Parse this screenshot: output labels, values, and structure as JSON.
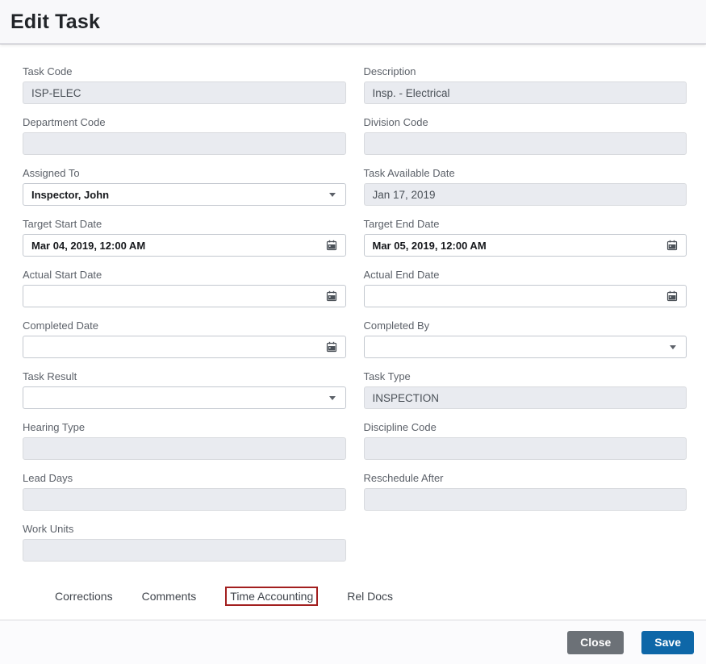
{
  "header": {
    "title": "Edit Task"
  },
  "form": {
    "fields": {
      "task_code": {
        "label": "Task Code",
        "value": "ISP-ELEC"
      },
      "description": {
        "label": "Description",
        "value": "Insp. - Electrical"
      },
      "department_code": {
        "label": "Department Code",
        "value": ""
      },
      "division_code": {
        "label": "Division Code",
        "value": ""
      },
      "assigned_to": {
        "label": "Assigned To",
        "value": "Inspector, John"
      },
      "task_available_date": {
        "label": "Task Available Date",
        "value": "Jan 17, 2019"
      },
      "target_start_date": {
        "label": "Target Start Date",
        "value": "Mar 04, 2019, 12:00 AM"
      },
      "target_end_date": {
        "label": "Target End Date",
        "value": "Mar 05, 2019, 12:00 AM"
      },
      "actual_start_date": {
        "label": "Actual Start Date",
        "value": ""
      },
      "actual_end_date": {
        "label": "Actual End Date",
        "value": ""
      },
      "completed_date": {
        "label": "Completed Date",
        "value": ""
      },
      "completed_by": {
        "label": "Completed By",
        "value": ""
      },
      "task_result": {
        "label": "Task Result",
        "value": ""
      },
      "task_type": {
        "label": "Task Type",
        "value": "INSPECTION"
      },
      "hearing_type": {
        "label": "Hearing Type",
        "value": ""
      },
      "discipline_code": {
        "label": "Discipline Code",
        "value": ""
      },
      "lead_days": {
        "label": "Lead Days",
        "value": ""
      },
      "reschedule_after": {
        "label": "Reschedule After",
        "value": ""
      },
      "work_units": {
        "label": "Work Units",
        "value": ""
      }
    }
  },
  "tabs": {
    "corrections": "Corrections",
    "comments": "Comments",
    "time_accounting": "Time Accounting",
    "rel_docs": "Rel Docs",
    "highlighted_tab": "Time Accounting"
  },
  "footer": {
    "close_label": "Close",
    "save_label": "Save"
  },
  "icons": {
    "calendar": "calendar-icon",
    "caret_down": "chevron-down-icon"
  },
  "colors": {
    "save_button": "#0e67a8",
    "close_button": "#6c7177",
    "highlight_border": "#a21f1f",
    "disabled_field_bg": "#e9ebf0"
  }
}
